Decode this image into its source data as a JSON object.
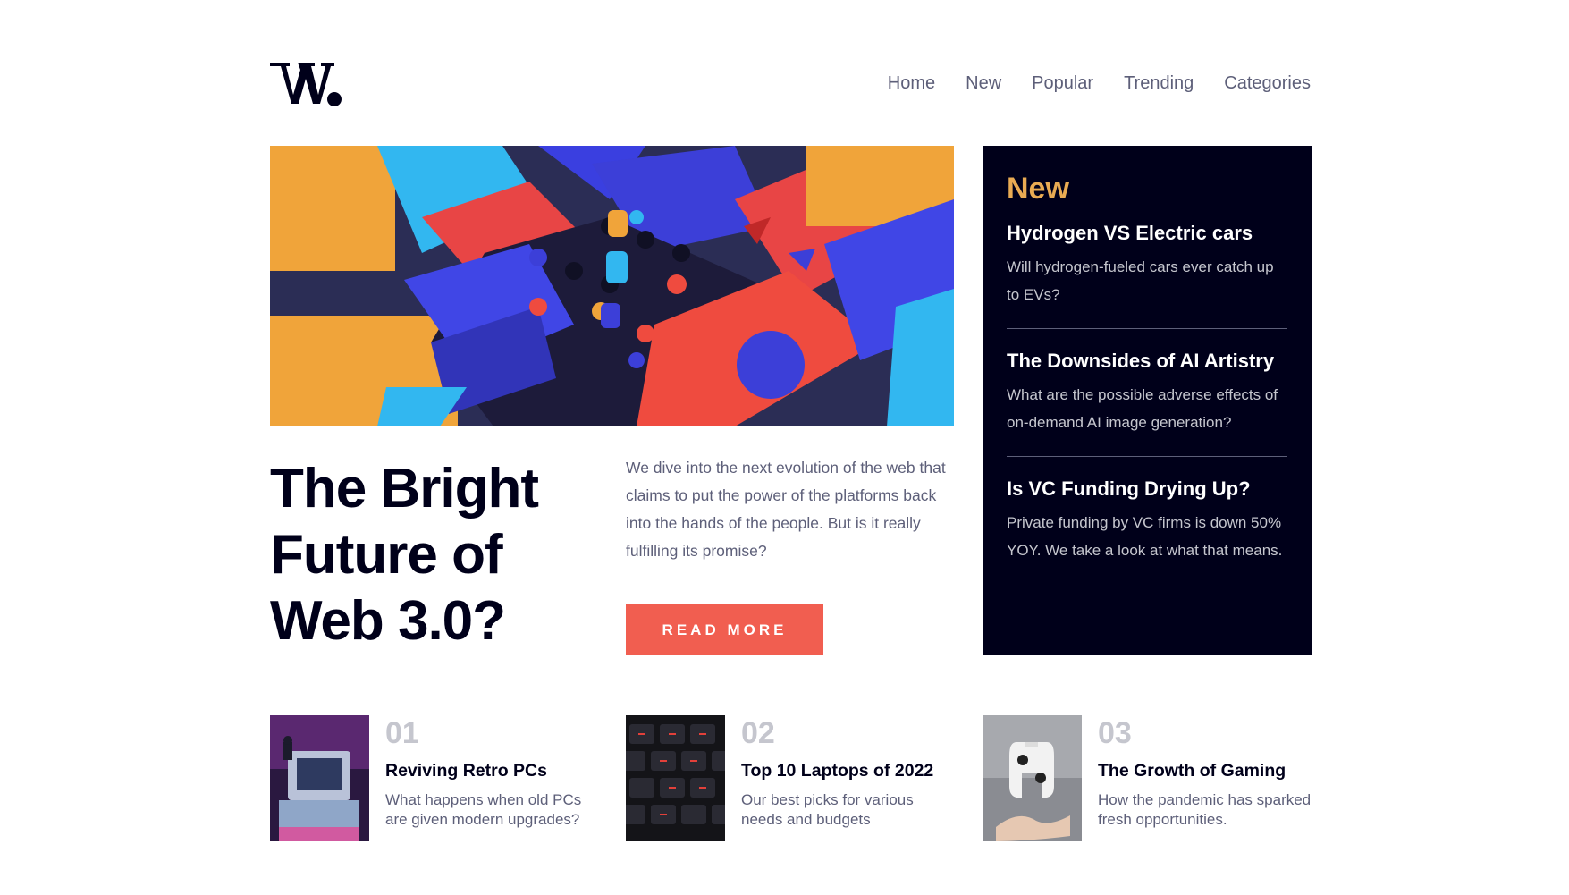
{
  "brand": {
    "logo_text": "W."
  },
  "nav": {
    "items": [
      {
        "label": "Home"
      },
      {
        "label": "New"
      },
      {
        "label": "Popular"
      },
      {
        "label": "Trending"
      },
      {
        "label": "Categories"
      }
    ]
  },
  "hero": {
    "title": "The Bright Future of Web 3.0?",
    "description": "We dive into the next evolution of the web that claims to put the power of the platforms back into the hands of the people. But is it really fulfilling its promise?",
    "button_label": "READ MORE"
  },
  "new_panel": {
    "title": "New",
    "items": [
      {
        "title": "Hydrogen VS Electric cars",
        "description": "Will hydrogen-fueled cars ever catch up to EVs?"
      },
      {
        "title": "The Downsides of AI Artistry",
        "description": "What are the possible adverse effects of on-demand AI image generation?"
      },
      {
        "title": "Is VC Funding Drying Up?",
        "description": "Private funding by VC firms is down 50% YOY. We take a look at what that means."
      }
    ]
  },
  "articles": [
    {
      "number": "01",
      "title": "Reviving Retro PCs",
      "description": "What happens when old PCs are given modern upgrades?"
    },
    {
      "number": "02",
      "title": "Top 10 Laptops of 2022",
      "description": "Our best picks for various needs and budgets"
    },
    {
      "number": "03",
      "title": "The Growth of Gaming",
      "description": "How the pandemic has sparked fresh opportunities."
    }
  ],
  "colors": {
    "accent_orange": "#e9ab53",
    "button_red": "#f15e50",
    "dark_navy": "#00001a",
    "grayish_blue": "#5d5f79",
    "light_gray": "#c5c6ce"
  }
}
